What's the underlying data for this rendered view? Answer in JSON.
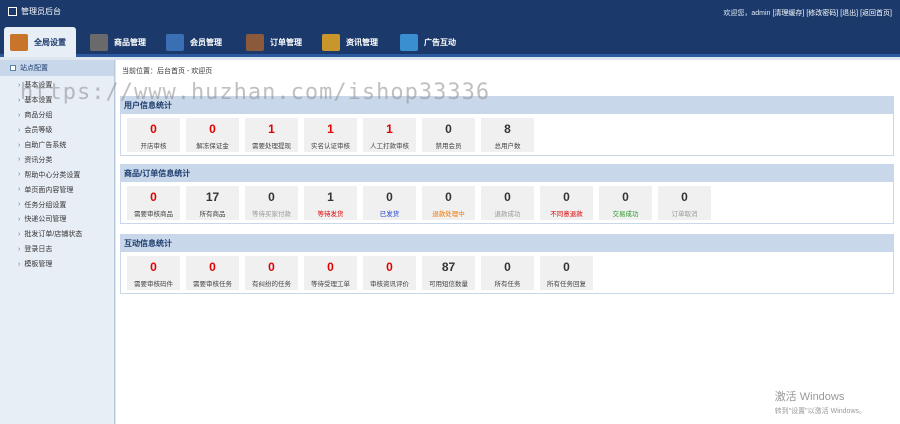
{
  "app": {
    "title": "管理员后台"
  },
  "top_links": {
    "welcome": "欢迎您，admin",
    "clear_cache": "[清理缓存]",
    "change_password": "[修改密码]",
    "logout": "[退出]",
    "home": "[返回首页]"
  },
  "nav": [
    {
      "label": "全局设置",
      "icon": "settings-icon",
      "color": "#c8742a",
      "active": true
    },
    {
      "label": "商品管理",
      "icon": "product-icon",
      "color": "#6a6a6a"
    },
    {
      "label": "会员管理",
      "icon": "member-icon",
      "color": "#3a6fb5"
    },
    {
      "label": "订单管理",
      "icon": "order-icon",
      "color": "#8a5a3a"
    },
    {
      "label": "资讯管理",
      "icon": "news-icon",
      "color": "#c8962a"
    },
    {
      "label": "广告互动",
      "icon": "ad-icon",
      "color": "#3a8fd0"
    }
  ],
  "sidebar": {
    "head": "站点配置",
    "items": [
      "基本设置",
      "基本设置",
      "商品分组",
      "会员等级",
      "自助广告系统",
      "资讯分类",
      "帮助中心分类设置",
      "单页面内容管理",
      "任务分组设置",
      "快递公司管理",
      "批发订单/店铺状态",
      "登录日志",
      "模板管理"
    ]
  },
  "breadcrumb": "当前位置：后台首页 - 欢迎页",
  "watermark": "https://www.huzhan.com/ishop33336",
  "sections": [
    {
      "title": "用户信息统计",
      "stats": [
        {
          "value": "0",
          "label": "开店审核",
          "color": "#e00000",
          "label_color": "#444444"
        },
        {
          "value": "0",
          "label": "解冻保证金",
          "color": "#e00000",
          "label_color": "#444444"
        },
        {
          "value": "1",
          "label": "需要处理提现",
          "color": "#e00000",
          "label_color": "#444444"
        },
        {
          "value": "1",
          "label": "实名认证审核",
          "color": "#e00000",
          "label_color": "#444444"
        },
        {
          "value": "1",
          "label": "人工打款审核",
          "color": "#e00000",
          "label_color": "#444444"
        },
        {
          "value": "0",
          "label": "禁用会员",
          "color": "#333333",
          "label_color": "#444444"
        },
        {
          "value": "8",
          "label": "总用户数",
          "color": "#333333",
          "label_color": "#444444"
        }
      ]
    },
    {
      "title": "商品/订单信息统计",
      "stats": [
        {
          "value": "0",
          "label": "需要审核商品",
          "color": "#e00000",
          "label_color": "#444444"
        },
        {
          "value": "17",
          "label": "所有商品",
          "color": "#333333",
          "label_color": "#444444"
        },
        {
          "value": "0",
          "label": "等待买家付款",
          "color": "#333333",
          "label_color": "#999999"
        },
        {
          "value": "1",
          "label": "等待发货",
          "color": "#333333",
          "label_color": "#e00000"
        },
        {
          "value": "0",
          "label": "已发货",
          "color": "#333333",
          "label_color": "#1a3fd0"
        },
        {
          "value": "0",
          "label": "退款处理中",
          "color": "#333333",
          "label_color": "#f07800"
        },
        {
          "value": "0",
          "label": "退款成功",
          "color": "#333333",
          "label_color": "#999999"
        },
        {
          "value": "0",
          "label": "不同意退款",
          "color": "#333333",
          "label_color": "#e00000"
        },
        {
          "value": "0",
          "label": "交易成功",
          "color": "#333333",
          "label_color": "#2a9a2a"
        },
        {
          "value": "0",
          "label": "订单取消",
          "color": "#333333",
          "label_color": "#999999"
        }
      ]
    },
    {
      "title": "互动信息统计",
      "stats": [
        {
          "value": "0",
          "label": "需要审核码件",
          "color": "#e00000",
          "label_color": "#444444"
        },
        {
          "value": "0",
          "label": "需要审核任务",
          "color": "#e00000",
          "label_color": "#444444"
        },
        {
          "value": "0",
          "label": "有纠纷的任务",
          "color": "#e00000",
          "label_color": "#444444"
        },
        {
          "value": "0",
          "label": "等待受理工单",
          "color": "#e00000",
          "label_color": "#444444"
        },
        {
          "value": "0",
          "label": "审核资讯评价",
          "color": "#e00000",
          "label_color": "#444444"
        },
        {
          "value": "87",
          "label": "可用短信数量",
          "color": "#333333",
          "label_color": "#444444"
        },
        {
          "value": "0",
          "label": "所有任务",
          "color": "#333333",
          "label_color": "#444444"
        },
        {
          "value": "0",
          "label": "所有任务回复",
          "color": "#333333",
          "label_color": "#444444"
        }
      ]
    }
  ],
  "activation": {
    "line1": "激活 Windows",
    "line2": "转到\"设置\"以激活 Windows。"
  }
}
